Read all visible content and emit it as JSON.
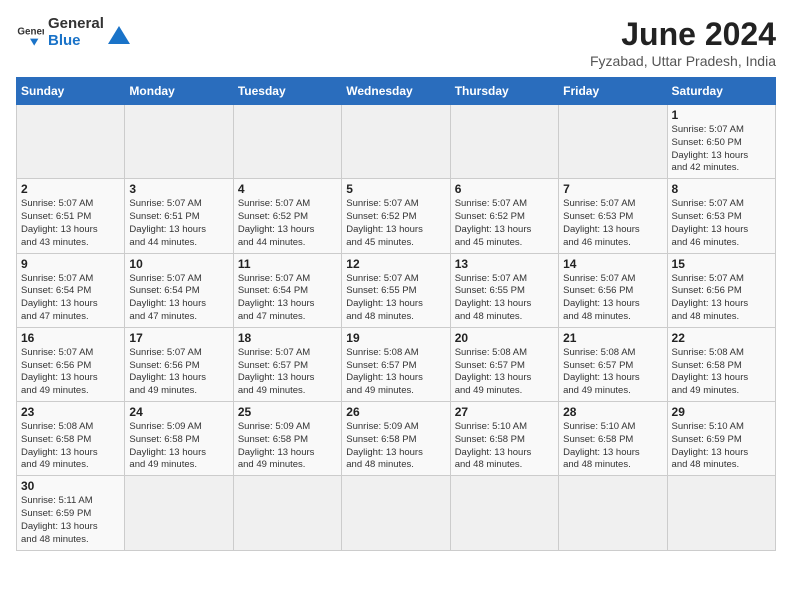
{
  "header": {
    "logo_general": "General",
    "logo_blue": "Blue",
    "title": "June 2024",
    "subtitle": "Fyzabad, Uttar Pradesh, India"
  },
  "weekdays": [
    "Sunday",
    "Monday",
    "Tuesday",
    "Wednesday",
    "Thursday",
    "Friday",
    "Saturday"
  ],
  "weeks": [
    [
      {
        "day": "",
        "info": ""
      },
      {
        "day": "",
        "info": ""
      },
      {
        "day": "",
        "info": ""
      },
      {
        "day": "",
        "info": ""
      },
      {
        "day": "",
        "info": ""
      },
      {
        "day": "",
        "info": ""
      },
      {
        "day": "1",
        "info": "Sunrise: 5:07 AM\nSunset: 6:50 PM\nDaylight: 13 hours\nand 42 minutes."
      }
    ],
    [
      {
        "day": "2",
        "info": "Sunrise: 5:07 AM\nSunset: 6:51 PM\nDaylight: 13 hours\nand 43 minutes."
      },
      {
        "day": "3",
        "info": "Sunrise: 5:07 AM\nSunset: 6:51 PM\nDaylight: 13 hours\nand 44 minutes."
      },
      {
        "day": "4",
        "info": "Sunrise: 5:07 AM\nSunset: 6:52 PM\nDaylight: 13 hours\nand 44 minutes."
      },
      {
        "day": "5",
        "info": "Sunrise: 5:07 AM\nSunset: 6:52 PM\nDaylight: 13 hours\nand 45 minutes."
      },
      {
        "day": "6",
        "info": "Sunrise: 5:07 AM\nSunset: 6:52 PM\nDaylight: 13 hours\nand 45 minutes."
      },
      {
        "day": "7",
        "info": "Sunrise: 5:07 AM\nSunset: 6:53 PM\nDaylight: 13 hours\nand 46 minutes."
      },
      {
        "day": "8",
        "info": "Sunrise: 5:07 AM\nSunset: 6:53 PM\nDaylight: 13 hours\nand 46 minutes."
      }
    ],
    [
      {
        "day": "9",
        "info": "Sunrise: 5:07 AM\nSunset: 6:54 PM\nDaylight: 13 hours\nand 47 minutes."
      },
      {
        "day": "10",
        "info": "Sunrise: 5:07 AM\nSunset: 6:54 PM\nDaylight: 13 hours\nand 47 minutes."
      },
      {
        "day": "11",
        "info": "Sunrise: 5:07 AM\nSunset: 6:54 PM\nDaylight: 13 hours\nand 47 minutes."
      },
      {
        "day": "12",
        "info": "Sunrise: 5:07 AM\nSunset: 6:55 PM\nDaylight: 13 hours\nand 48 minutes."
      },
      {
        "day": "13",
        "info": "Sunrise: 5:07 AM\nSunset: 6:55 PM\nDaylight: 13 hours\nand 48 minutes."
      },
      {
        "day": "14",
        "info": "Sunrise: 5:07 AM\nSunset: 6:56 PM\nDaylight: 13 hours\nand 48 minutes."
      },
      {
        "day": "15",
        "info": "Sunrise: 5:07 AM\nSunset: 6:56 PM\nDaylight: 13 hours\nand 48 minutes."
      }
    ],
    [
      {
        "day": "16",
        "info": "Sunrise: 5:07 AM\nSunset: 6:56 PM\nDaylight: 13 hours\nand 49 minutes."
      },
      {
        "day": "17",
        "info": "Sunrise: 5:07 AM\nSunset: 6:56 PM\nDaylight: 13 hours\nand 49 minutes."
      },
      {
        "day": "18",
        "info": "Sunrise: 5:07 AM\nSunset: 6:57 PM\nDaylight: 13 hours\nand 49 minutes."
      },
      {
        "day": "19",
        "info": "Sunrise: 5:08 AM\nSunset: 6:57 PM\nDaylight: 13 hours\nand 49 minutes."
      },
      {
        "day": "20",
        "info": "Sunrise: 5:08 AM\nSunset: 6:57 PM\nDaylight: 13 hours\nand 49 minutes."
      },
      {
        "day": "21",
        "info": "Sunrise: 5:08 AM\nSunset: 6:57 PM\nDaylight: 13 hours\nand 49 minutes."
      },
      {
        "day": "22",
        "info": "Sunrise: 5:08 AM\nSunset: 6:58 PM\nDaylight: 13 hours\nand 49 minutes."
      }
    ],
    [
      {
        "day": "23",
        "info": "Sunrise: 5:08 AM\nSunset: 6:58 PM\nDaylight: 13 hours\nand 49 minutes."
      },
      {
        "day": "24",
        "info": "Sunrise: 5:09 AM\nSunset: 6:58 PM\nDaylight: 13 hours\nand 49 minutes."
      },
      {
        "day": "25",
        "info": "Sunrise: 5:09 AM\nSunset: 6:58 PM\nDaylight: 13 hours\nand 49 minutes."
      },
      {
        "day": "26",
        "info": "Sunrise: 5:09 AM\nSunset: 6:58 PM\nDaylight: 13 hours\nand 48 minutes."
      },
      {
        "day": "27",
        "info": "Sunrise: 5:10 AM\nSunset: 6:58 PM\nDaylight: 13 hours\nand 48 minutes."
      },
      {
        "day": "28",
        "info": "Sunrise: 5:10 AM\nSunset: 6:58 PM\nDaylight: 13 hours\nand 48 minutes."
      },
      {
        "day": "29",
        "info": "Sunrise: 5:10 AM\nSunset: 6:59 PM\nDaylight: 13 hours\nand 48 minutes."
      }
    ],
    [
      {
        "day": "30",
        "info": "Sunrise: 5:11 AM\nSunset: 6:59 PM\nDaylight: 13 hours\nand 48 minutes."
      },
      {
        "day": "",
        "info": ""
      },
      {
        "day": "",
        "info": ""
      },
      {
        "day": "",
        "info": ""
      },
      {
        "day": "",
        "info": ""
      },
      {
        "day": "",
        "info": ""
      },
      {
        "day": "",
        "info": ""
      }
    ]
  ]
}
